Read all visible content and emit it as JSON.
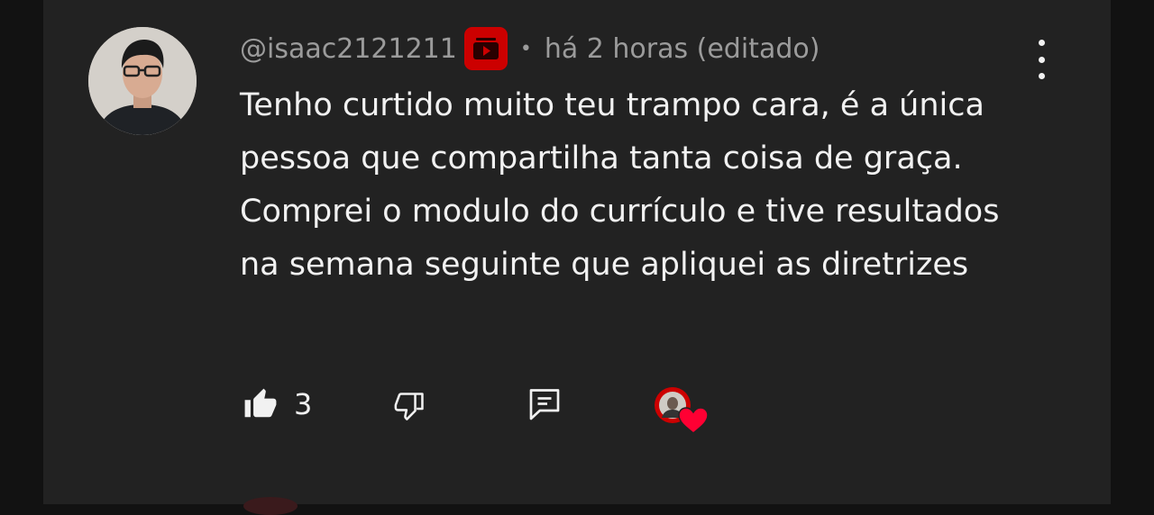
{
  "comment": {
    "username": "@isaac2121211",
    "separator": "•",
    "time": "há 2 horas (editado)",
    "text": "Tenho curtido muito teu trampo cara, é a única pessoa que compartilha tanta coisa de graça. Comprei o modulo do currículo e tive resultados na semana seguinte que apliquei as diretrizes",
    "like_count": "3",
    "icons": {
      "avatar": "user-avatar",
      "member_badge": "youtube-member-badge-icon",
      "more": "more-vertical-icon",
      "like": "thumbs-up-icon",
      "dislike": "thumbs-down-icon",
      "reply": "reply-icon",
      "creator_heart": "creator-heart-icon"
    }
  },
  "colors": {
    "background": "#121212",
    "card": "#222222",
    "text_primary": "#f1f1f1",
    "text_secondary": "#9b9b9b",
    "accent_red": "#cc0000",
    "heart_red": "#ff0033"
  }
}
